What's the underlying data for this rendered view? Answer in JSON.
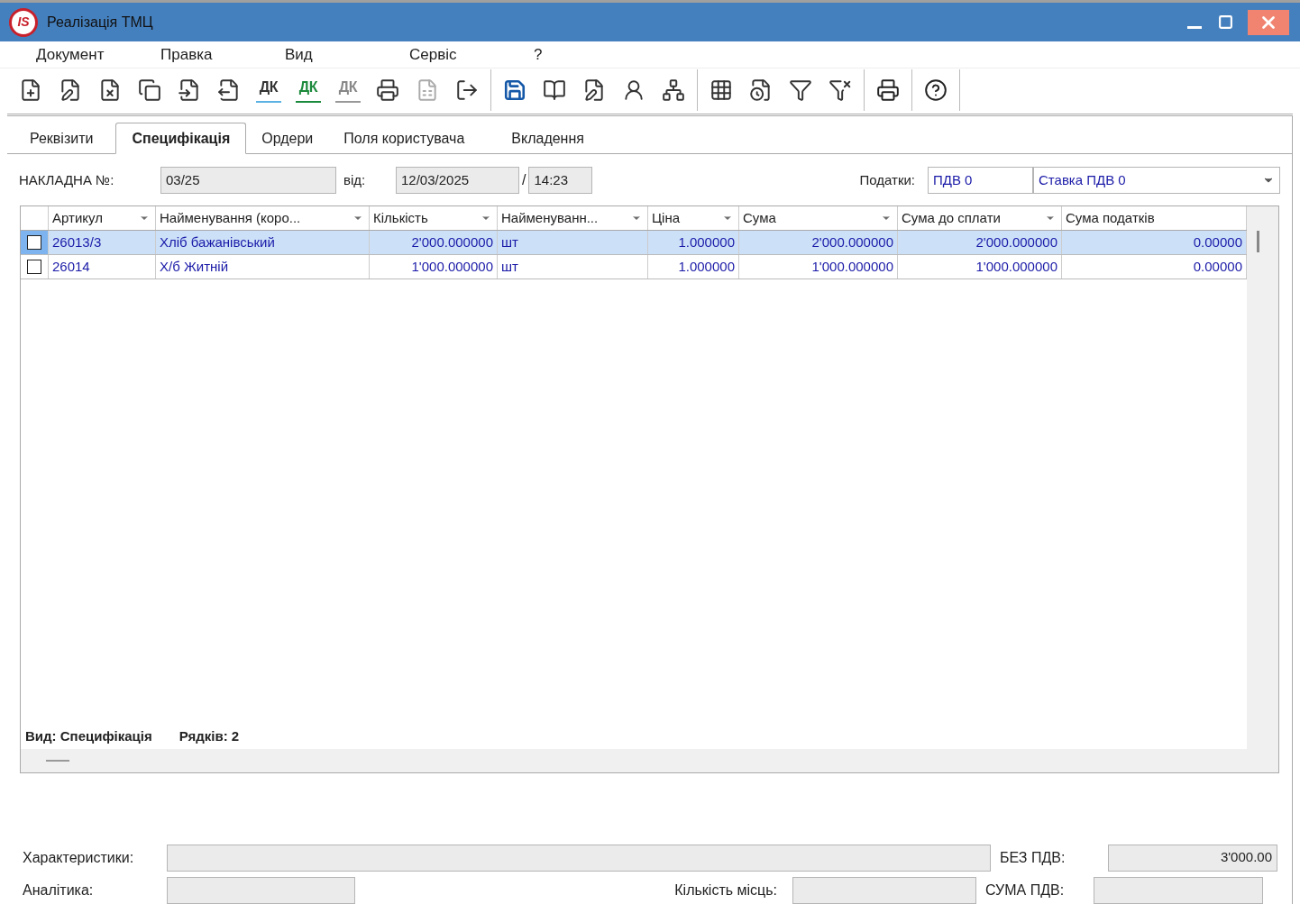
{
  "window": {
    "title": "Реалізація ТМЦ",
    "logo": "IS"
  },
  "menu": [
    "Документ",
    "Правка",
    "Вид",
    "Сервіс",
    "?"
  ],
  "toolbar": [
    [
      {
        "kind": "new",
        "disabled": false
      },
      {
        "kind": "edit",
        "disabled": false
      },
      {
        "kind": "delete",
        "disabled": false
      },
      {
        "kind": "copy",
        "disabled": false
      },
      {
        "kind": "import",
        "disabled": false
      },
      {
        "kind": "export",
        "disabled": false
      },
      {
        "kind": "dk_blue",
        "label": "ДК",
        "disabled": false
      },
      {
        "kind": "dk_green",
        "label": "ДК",
        "disabled": false
      },
      {
        "kind": "dk_gray",
        "label": "ДК",
        "disabled": true
      },
      {
        "kind": "print_copy",
        "disabled": false
      },
      {
        "kind": "excel",
        "disabled": true
      },
      {
        "kind": "exit",
        "disabled": false
      }
    ],
    [
      {
        "kind": "save",
        "disabled": false
      },
      {
        "kind": "book",
        "disabled": false
      },
      {
        "kind": "edit_doc",
        "disabled": false
      },
      {
        "kind": "user_msg",
        "disabled": false
      },
      {
        "kind": "tree",
        "disabled": false
      }
    ],
    [
      {
        "kind": "grid",
        "disabled": false
      },
      {
        "kind": "history",
        "disabled": false
      },
      {
        "kind": "filter",
        "disabled": false
      },
      {
        "kind": "filter_clear",
        "disabled": false
      }
    ],
    [
      {
        "kind": "print",
        "disabled": false
      }
    ],
    [
      {
        "kind": "help",
        "disabled": false
      }
    ]
  ],
  "tabs": [
    {
      "label": "Реквізити",
      "selected": false
    },
    {
      "label": "Специфікація",
      "selected": true
    },
    {
      "label": "Ордери",
      "selected": false
    },
    {
      "label": "Поля користувача",
      "selected": false
    },
    {
      "label": "Вкладення",
      "selected": false
    }
  ],
  "header": {
    "invoice_label": "НАКЛАДНА №:",
    "invoice_number": "03/25",
    "date_label": "від:",
    "date": "12/03/2025",
    "separator": "/",
    "time": "14:23",
    "taxes_label": "Податки:",
    "tax_code": "ПДВ  0",
    "tax_rate": "Ставка ПДВ 0"
  },
  "table": {
    "columns": [
      {
        "label": "Артикул",
        "menu": true
      },
      {
        "label": "Найменування (коро...",
        "menu": true
      },
      {
        "label": "Кількість",
        "menu": true
      },
      {
        "label": "Найменуванн...",
        "menu": true
      },
      {
        "label": "Ціна",
        "menu": true
      },
      {
        "label": "Сума",
        "menu": true
      },
      {
        "label": "Сума до сплати",
        "menu": true
      },
      {
        "label": "Сума податків",
        "menu": false
      }
    ],
    "rows": [
      {
        "selected": true,
        "checked": false,
        "cells": [
          "26013/3",
          "Хліб бажанівський",
          "2'000.000000",
          "шт",
          "1.000000",
          "2'000.000000",
          "2'000.000000",
          "0.00000"
        ]
      },
      {
        "selected": false,
        "checked": false,
        "cells": [
          "26014",
          "Х/б Житній",
          "1'000.000000",
          "шт",
          "1.000000",
          "1'000.000000",
          "1'000.000000",
          "0.00000"
        ]
      }
    ],
    "status": [
      "Вид: Специфікація",
      "Рядків: 2"
    ]
  },
  "footer": {
    "characteristics_label": "Характеристики:",
    "analytics_label": "Аналітика:",
    "places_label": "Кількість місць:",
    "without_vat_label": "БЕЗ ПДВ:",
    "without_vat": "3'000.00",
    "vat_label": "СУМА ПДВ:"
  }
}
